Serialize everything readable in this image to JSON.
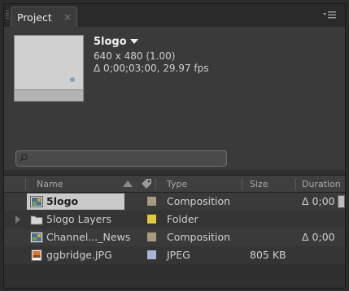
{
  "tab": {
    "label": "Project",
    "close": "×"
  },
  "panel_menu_icon": "panel-menu-icon",
  "info": {
    "name": "5logo",
    "dimensions": "640 x 480 (1.00)",
    "duration_fps": "Δ 0;00;03;00, 29.97 fps"
  },
  "search": {
    "placeholder": "",
    "value": "",
    "icon": "search-icon"
  },
  "columns": {
    "name": "Name",
    "type": "Type",
    "size": "Size",
    "duration": "Duration"
  },
  "rows": [
    {
      "name": "5logo",
      "type": "Composition",
      "size": "",
      "duration": "Δ 0;00",
      "icon": "composition-icon",
      "label_color": "#a89a83",
      "selected": true,
      "expandable": false
    },
    {
      "name": "5logo Layers",
      "type": "Folder",
      "size": "",
      "duration": "",
      "icon": "folder-icon",
      "label_color": "#e0c93a",
      "selected": false,
      "expandable": true
    },
    {
      "name": "Channel..._News",
      "type": "Composition",
      "size": "",
      "duration": "Δ 0;00",
      "icon": "composition-icon",
      "label_color": "#a89a83",
      "selected": false,
      "expandable": false
    },
    {
      "name": "ggbridge.JPG",
      "type": "JPEG",
      "size": "805 KB",
      "duration": "",
      "icon": "jpeg-file-icon",
      "label_color": "#a9b3d6",
      "selected": false,
      "expandable": false
    }
  ]
}
